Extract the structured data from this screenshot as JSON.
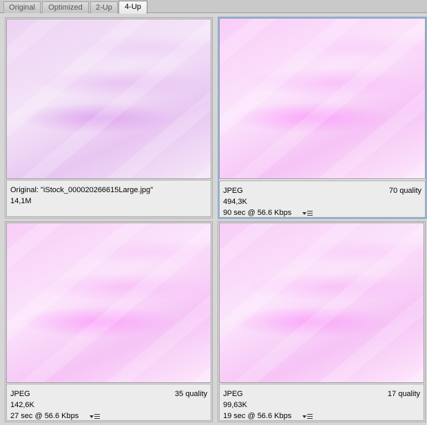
{
  "tabs": [
    {
      "label": "Original",
      "active": false
    },
    {
      "label": "Optimized",
      "active": false
    },
    {
      "label": "2-Up",
      "active": false
    },
    {
      "label": "4-Up",
      "active": true
    }
  ],
  "panels": [
    {
      "line1": "Original: \"iStock_000020266615Large.jpg\"",
      "line2": "14,1M",
      "selected": false
    },
    {
      "line1": "JPEG",
      "quality": "70 quality",
      "line2": "494,3K",
      "line3": "90 sec @ 56.6 Kbps",
      "selected": true
    },
    {
      "line1": "JPEG",
      "quality": "35 quality",
      "line2": "142,6K",
      "line3": "27 sec @ 56.6 Kbps",
      "selected": false
    },
    {
      "line1": "JPEG",
      "quality": "17 quality",
      "line2": "99,63K",
      "line3": "19 sec @ 56.6 Kbps",
      "selected": false
    }
  ],
  "icons": {
    "download_menu": "download-speed-menu-icon"
  },
  "colors": {
    "selection_border": "#8fb2d8"
  }
}
